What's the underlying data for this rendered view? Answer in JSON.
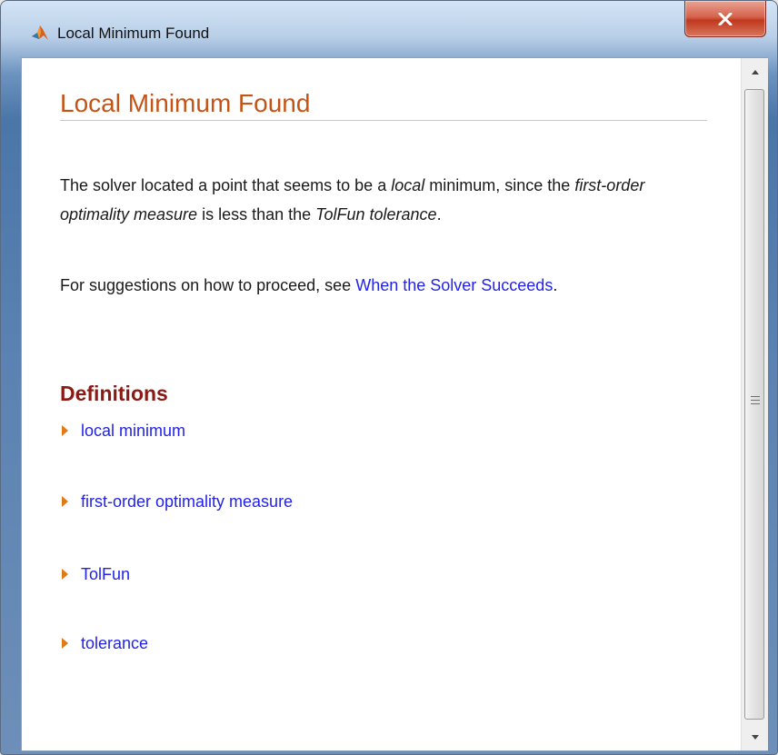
{
  "window": {
    "title": "Local Minimum Found",
    "close_label": "x"
  },
  "page": {
    "title": "Local Minimum Found",
    "paragraph1": {
      "t1": "The solver located a point that seems to be a ",
      "em1": "local",
      "t2": " minimum, since the ",
      "em2": "first-order optimality measure",
      "t3": " is less than the ",
      "em3": "TolFun tolerance",
      "t4": "."
    },
    "paragraph2": {
      "t1": "For suggestions on how to proceed, see ",
      "link": "When the Solver Succeeds",
      "t2": "."
    },
    "definitions": {
      "heading": "Definitions",
      "items": [
        {
          "label": "local minimum"
        },
        {
          "label": "first-order optimality measure"
        },
        {
          "label": "TolFun"
        },
        {
          "label": "tolerance"
        }
      ]
    }
  },
  "colors": {
    "title": "#c45416",
    "heading": "#8b1a14",
    "link": "#2222ee",
    "arrow": "#e07a17"
  }
}
